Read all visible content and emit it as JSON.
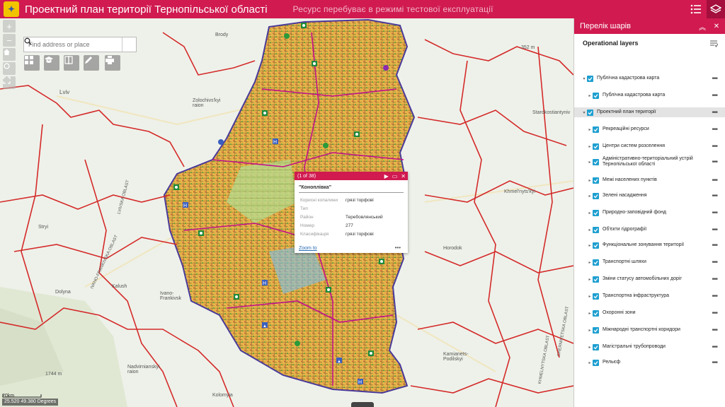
{
  "header": {
    "logo_text": "✦",
    "title": "Проектний план території Тернопільської області",
    "subtitle": "Ресурс перебуває в режимі тестової експлуатації",
    "list_icon": "layer-list-icon",
    "layers_icon": "layers-icon"
  },
  "search": {
    "placeholder": "Find address or place"
  },
  "map_labels": {
    "brody": "Brody",
    "lviv": "Lviv",
    "zolochiv": "Zolochivs'kyi raion",
    "khmelnytskyi": "Khmel'nyts'kyi",
    "horodok": "Horodok",
    "stryi": "Stryi",
    "dolyna": "Dolyna",
    "kalush": "Kalush",
    "ivano": "Ivano-Frankivsk",
    "nadvirna": "Nadvirnianskyi raion",
    "kolomyia": "Kolomyia",
    "kamianets": "Kamianets-Podilskyi",
    "m352": "352 m",
    "m1744": "1744 m",
    "starokost": "Starokostiantyniv",
    "lvivobl": "LVIVSKA OBLAST",
    "ivfobl": "IVANO-FRANKIVSKA OBLAST",
    "khmobl": "KHMELNYTSKA OBLAST",
    "chernobl": "CHERNIVETSKA OBLAST"
  },
  "popup": {
    "counter": "(1 of 38)",
    "title": "\"Коноплівка\"",
    "attributes": [
      {
        "k": "Корисні копалини",
        "v": "грязі торфові"
      },
      {
        "k": "Тип",
        "v": ""
      },
      {
        "k": "Район",
        "v": "Теребовлянський"
      },
      {
        "k": "Номер",
        "v": "277"
      },
      {
        "k": "Класифікація",
        "v": "грязі торфові"
      }
    ],
    "zoom_label": "Zoom to",
    "more": "•••"
  },
  "scale": {
    "label": "20km"
  },
  "coords": {
    "text": "25.520 49.380 Degrees"
  },
  "panel": {
    "title": "Перелік шарів",
    "operational": "Operational layers",
    "layers": [
      {
        "label": "Публічна кадастрова карта",
        "level": 0,
        "expanded": true
      },
      {
        "label": "Публічна кадастрова карта",
        "level": 1
      },
      {
        "label": "Проектний план території",
        "level": 0,
        "expanded": true,
        "highlight": true
      },
      {
        "label": "Рекреаційні ресурси",
        "level": 1
      },
      {
        "label": "Центри систем розселення",
        "level": 1
      },
      {
        "label": "Адміністративно-територіальний устрій Тернопільської області",
        "level": 1
      },
      {
        "label": "Межі населених пунктів",
        "level": 1
      },
      {
        "label": "Зелені насадження",
        "level": 1
      },
      {
        "label": "Природно-заповідний фонд",
        "level": 1
      },
      {
        "label": "Об'єкти гідрографії",
        "level": 1
      },
      {
        "label": "Функціональне зонування території",
        "level": 1
      },
      {
        "label": "Транспортні шляхи",
        "level": 1
      },
      {
        "label": "Зміни статусу автомобільних доріг",
        "level": 1
      },
      {
        "label": "Транспортна інфраструктура",
        "level": 1
      },
      {
        "label": "Охоронні зони",
        "level": 1
      },
      {
        "label": "Міжнародні транспортні коридори",
        "level": 1
      },
      {
        "label": "Магістральні трубопроводи",
        "level": 1
      },
      {
        "label": "Рельєф",
        "level": 1
      }
    ]
  },
  "colors": {
    "accent": "#d01a50",
    "checkbox": "#1e9fd0",
    "region_fill": "#e8b54a",
    "border": "#d42a2a"
  }
}
